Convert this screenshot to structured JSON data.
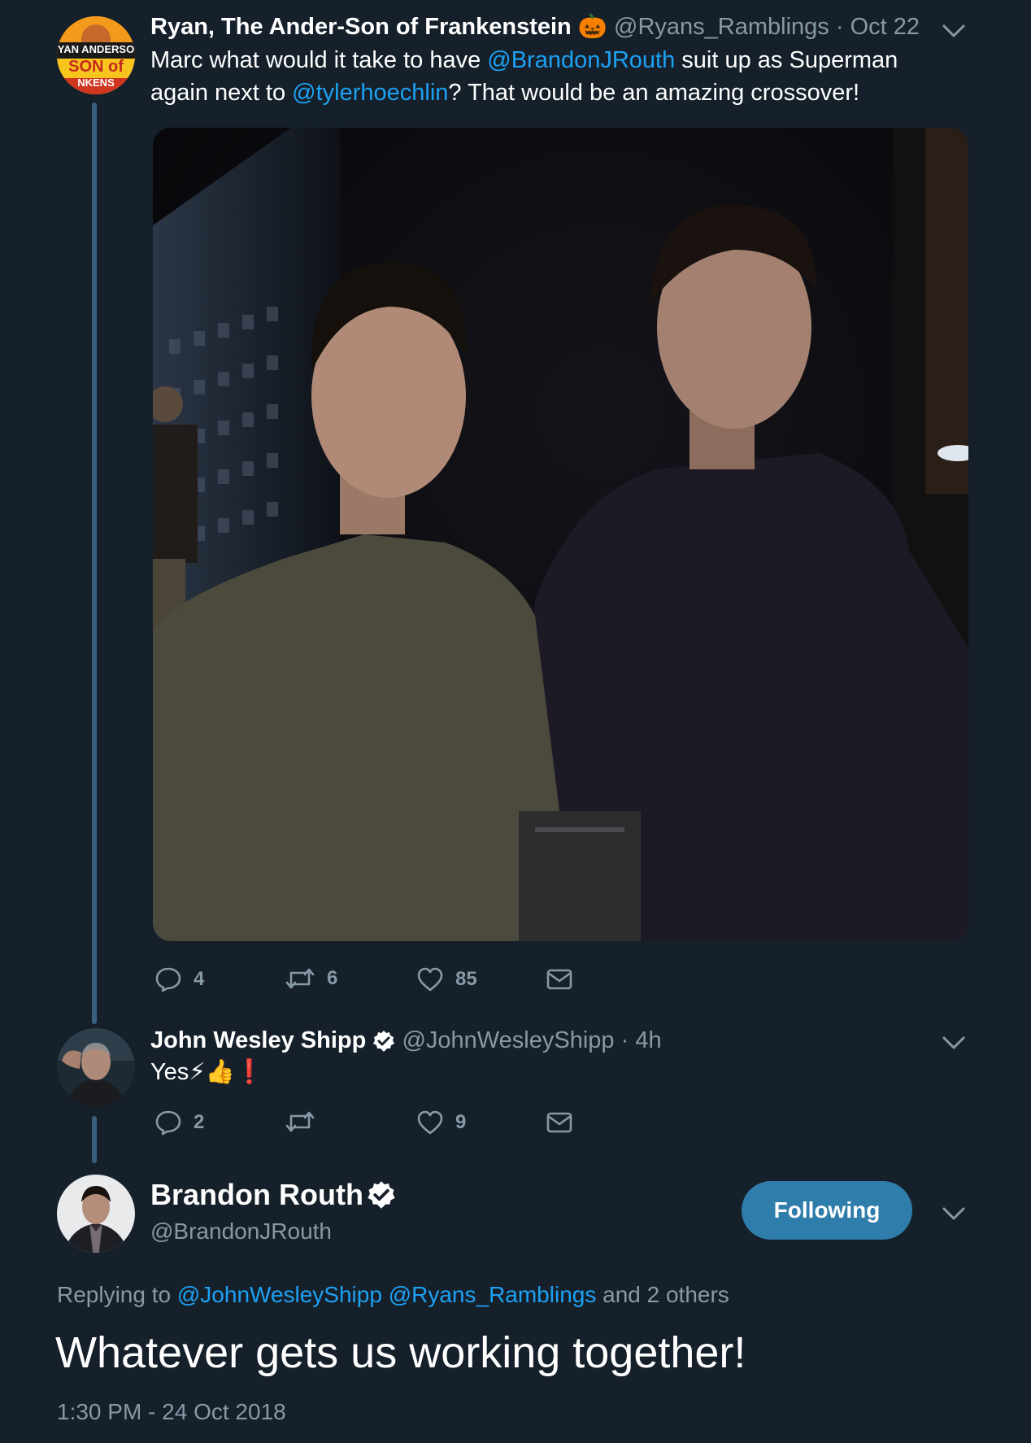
{
  "tweet1": {
    "author_name": "Ryan, The Ander-Son of Frankenstein",
    "author_emoji": "🎃",
    "handle": "@Ryans_Ramblings",
    "separator": "·",
    "time": "Oct 22",
    "avatar_text": {
      "line1": "YAN ANDERSO",
      "line2": "SON of",
      "line3": "NKENS"
    },
    "text_part1": "Marc what would it take to have ",
    "mention1": "@BrandonJRouth",
    "text_part2": " suit up as Superman again next to ",
    "mention2": "@tylerhoechlin",
    "text_part3": "? That would be an amazing crossover!",
    "counts": {
      "replies": "4",
      "retweets": "6",
      "likes": "85"
    }
  },
  "tweet2": {
    "author_name": "John Wesley Shipp",
    "handle": "@JohnWesleyShipp",
    "separator": "·",
    "time": "4h",
    "text": "Yes",
    "emojis": "⚡👍❗",
    "counts": {
      "replies": "2",
      "retweets": "",
      "likes": "9"
    }
  },
  "tweet3": {
    "author_name": "Brandon Routh",
    "handle": "@BrandonJRouth",
    "follow_label": "Following",
    "replying_prefix": "Replying to ",
    "reply_mention1": "@JohnWesleyShipp",
    "reply_mention2": "@Ryans_Ramblings",
    "replying_suffix": " and 2 others",
    "text": "Whatever gets us working together!",
    "timestamp": "1:30 PM - 24 Oct 2018"
  },
  "colors": {
    "background": "#15202b",
    "link": "#1da1f2",
    "muted": "#8899a6",
    "thread_line": "#3b5f80",
    "follow_button": "#2f7dab"
  },
  "icons": [
    "reply-icon",
    "retweet-icon",
    "like-icon",
    "dm-icon",
    "chevron-down-icon",
    "verified-badge-icon"
  ]
}
